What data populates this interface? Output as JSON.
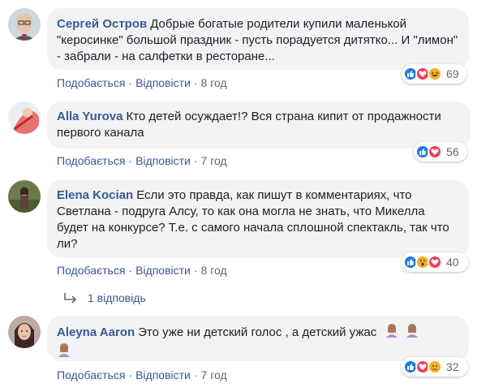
{
  "actions": {
    "like": "Подобається",
    "reply": "Відповісти",
    "separator": "·"
  },
  "colors": {
    "link": "#385898",
    "bubble": "#f2f3f5",
    "like_blue": "#1877f2",
    "love_red": "#f33e58",
    "haha_yellow": "#f7b125"
  },
  "comments": [
    {
      "author": "Сергей Остров",
      "text": "Добрые богатые родители купили маленькой \"керосинке\" большой праздник - пусть порадуется дитятко... И \"лимон\" - забрали - на салфетки в ресторане...",
      "time": "8 год",
      "reactions": [
        "like-icon",
        "love-icon",
        "haha-icon"
      ],
      "reaction_count": "69"
    },
    {
      "author": "Alla Yurova",
      "text": "Кто детей осуждает!? Вся страна кипит от продажности первого канала",
      "time": "7 год",
      "reactions": [
        "like-icon",
        "love-icon"
      ],
      "reaction_count": "56"
    },
    {
      "author": "Elena Kocian",
      "text": "Если это правда, как пишут в комментариях, что Светлана - подруга Алсу, то как она могла не знать, что Микелла будет на конкурсе? Т.е. с самого начала сплошной спектакль, так что ли?",
      "time": "8 год",
      "reactions": [
        "like-icon",
        "wow-icon",
        "love-icon"
      ],
      "reaction_count": "40"
    },
    {
      "author": "Aleyna Aaron",
      "text": "Это уже ни детский голос , а детский ужас",
      "time": "7 год",
      "reactions": [
        "like-icon",
        "love-icon",
        "sad-icon"
      ],
      "reaction_count": "32"
    }
  ],
  "replies_link": {
    "label": "1 відповідь",
    "icon": "reply-arrow-icon"
  }
}
